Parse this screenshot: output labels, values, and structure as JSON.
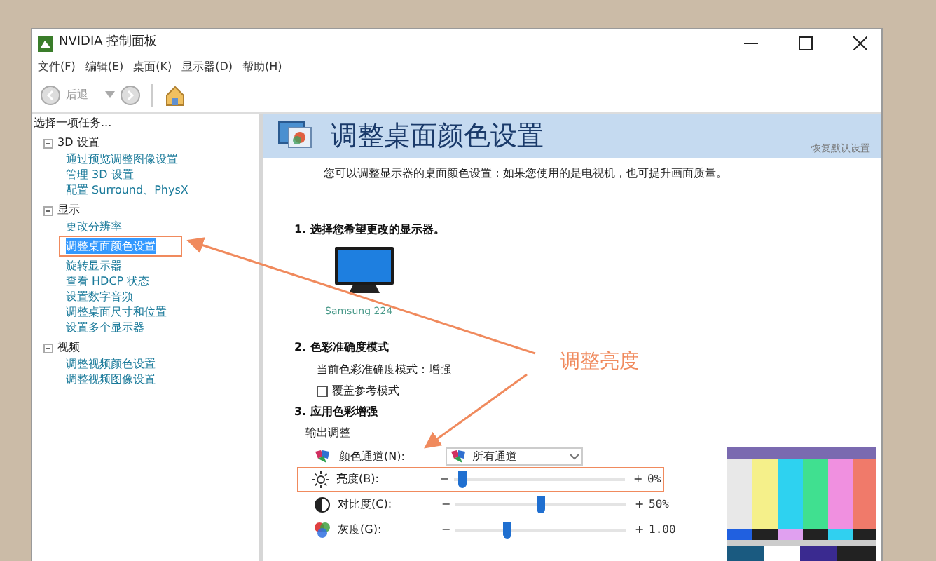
{
  "window": {
    "title": "NVIDIA 控制面板"
  },
  "menu": [
    "文件(F)",
    "编辑(E)",
    "桌面(K)",
    "显示器(D)",
    "帮助(H)"
  ],
  "toolbar": {
    "back_label": "后退"
  },
  "sidebar": {
    "header": "选择一项任务...",
    "groups": [
      {
        "label": "3D 设置",
        "expanded": true,
        "children": [
          {
            "label": "通过预览调整图像设置",
            "selected": false,
            "highlighted": false
          },
          {
            "label": "管理 3D 设置",
            "selected": false,
            "highlighted": false
          },
          {
            "label": "配置 Surround、PhysX",
            "selected": false,
            "highlighted": false
          }
        ]
      },
      {
        "label": "显示",
        "expanded": true,
        "children": [
          {
            "label": "更改分辨率",
            "selected": false,
            "highlighted": false
          },
          {
            "label": "调整桌面颜色设置",
            "selected": true,
            "highlighted": true
          },
          {
            "label": "旋转显示器",
            "selected": false,
            "highlighted": false
          },
          {
            "label": "查看 HDCP 状态",
            "selected": false,
            "highlighted": false
          },
          {
            "label": "设置数字音频",
            "selected": false,
            "highlighted": false
          },
          {
            "label": "调整桌面尺寸和位置",
            "selected": false,
            "highlighted": false
          },
          {
            "label": "设置多个显示器",
            "selected": false,
            "highlighted": false
          }
        ]
      },
      {
        "label": "视频",
        "expanded": true,
        "children": [
          {
            "label": "调整视频颜色设置",
            "selected": false,
            "highlighted": false
          },
          {
            "label": "调整视频图像设置",
            "selected": false,
            "highlighted": false
          }
        ]
      }
    ]
  },
  "content": {
    "title": "调整桌面颜色设置",
    "reset_link": "恢复默认设置",
    "description": "您可以调整显示器的桌面颜色设置：如果您使用的是电视机，也可提升画面质量。",
    "step1": {
      "heading": "1. 选择您希望更改的显示器。",
      "display": "Samsung 224"
    },
    "step2": {
      "heading": "2. 色彩准确度模式",
      "current_mode": "当前色彩准确度模式：增强",
      "override": {
        "label": "覆盖参考模式",
        "checked": false
      }
    },
    "step3": {
      "heading": "3. 应用色彩增强",
      "group": "输出调整",
      "channel_label": "颜色通道(N):",
      "channel_value": "所有通道",
      "sliders": [
        {
          "kind": "brightness",
          "label": "亮度(B):",
          "minus": "−",
          "plus": "+",
          "level": 0.05,
          "reading": "0%",
          "highlighted": true
        },
        {
          "kind": "contrast",
          "label": "对比度(C):",
          "minus": "−",
          "plus": "+",
          "level": 0.5,
          "reading": "50%",
          "highlighted": false
        },
        {
          "kind": "gamma",
          "label": "灰度(G):",
          "minus": "−",
          "plus": "+",
          "level": 0.3,
          "reading": "1.00",
          "highlighted": false
        }
      ]
    }
  },
  "annotation": {
    "label": "调整亮度"
  }
}
